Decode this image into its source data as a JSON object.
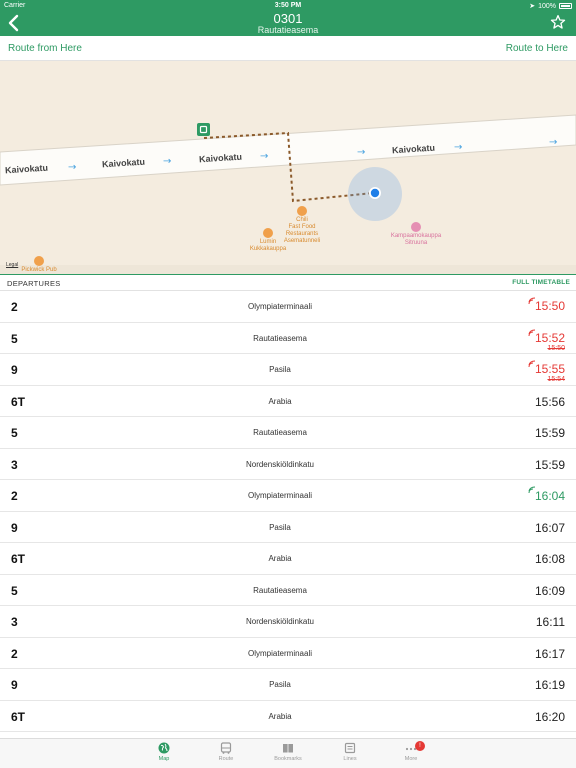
{
  "status": {
    "carrier": "Carrier",
    "time": "3:50 PM",
    "battery": "100%"
  },
  "nav": {
    "title": "0301",
    "subtitle": "Rautatieasema"
  },
  "route": {
    "from_label": "Route from Here",
    "to_label": "Route to Here"
  },
  "map": {
    "street_labels": [
      "Kaivokatu",
      "Kaivokatu",
      "Kaivokatu",
      "Kaivokatu"
    ],
    "pois": {
      "chili": "Chili\nFast Food\nRestaurants\nAsematunneli",
      "lumin": "Lumin\nKukkakauppa",
      "kampaamo": "Kampaamokauppa\nSitruuna",
      "pub": "Pickwick Pub"
    },
    "legal": "Legal"
  },
  "departures": {
    "title": "DEPARTURES",
    "full_timetable": "FULL TIMETABLE",
    "rows": [
      {
        "line": "2",
        "dest": "Olympiaterminaali",
        "time": "15:50",
        "old": "",
        "status": "late"
      },
      {
        "line": "5",
        "dest": "Rautatieasema",
        "time": "15:52",
        "old": "15:50",
        "status": "late"
      },
      {
        "line": "9",
        "dest": "Pasila",
        "time": "15:55",
        "old": "15:54",
        "status": "late"
      },
      {
        "line": "6T",
        "dest": "Arabia",
        "time": "15:56",
        "old": "",
        "status": "scheduled"
      },
      {
        "line": "5",
        "dest": "Rautatieasema",
        "time": "15:59",
        "old": "",
        "status": "scheduled"
      },
      {
        "line": "3",
        "dest": "Nordenskiöldinkatu",
        "time": "15:59",
        "old": "",
        "status": "scheduled"
      },
      {
        "line": "2",
        "dest": "Olympiaterminaali",
        "time": "16:04",
        "old": "",
        "status": "live"
      },
      {
        "line": "9",
        "dest": "Pasila",
        "time": "16:07",
        "old": "",
        "status": "scheduled"
      },
      {
        "line": "6T",
        "dest": "Arabia",
        "time": "16:08",
        "old": "",
        "status": "scheduled"
      },
      {
        "line": "5",
        "dest": "Rautatieasema",
        "time": "16:09",
        "old": "",
        "status": "scheduled"
      },
      {
        "line": "3",
        "dest": "Nordenskiöldinkatu",
        "time": "16:11",
        "old": "",
        "status": "scheduled"
      },
      {
        "line": "2",
        "dest": "Olympiaterminaali",
        "time": "16:17",
        "old": "",
        "status": "scheduled"
      },
      {
        "line": "9",
        "dest": "Pasila",
        "time": "16:19",
        "old": "",
        "status": "scheduled"
      },
      {
        "line": "6T",
        "dest": "Arabia",
        "time": "16:20",
        "old": "",
        "status": "scheduled"
      }
    ]
  },
  "tabs": [
    {
      "label": "Map",
      "icon": "globe-icon",
      "active": true
    },
    {
      "label": "Route",
      "icon": "bus-icon",
      "active": false
    },
    {
      "label": "Bookmarks",
      "icon": "book-icon",
      "active": false
    },
    {
      "label": "Lines",
      "icon": "tram-icon",
      "active": false
    },
    {
      "label": "More",
      "icon": "more-icon",
      "active": false,
      "badge": "!"
    }
  ],
  "colors": {
    "brand": "#2e9a63",
    "late": "#e53935",
    "map_bg": "#f4ecdf"
  }
}
